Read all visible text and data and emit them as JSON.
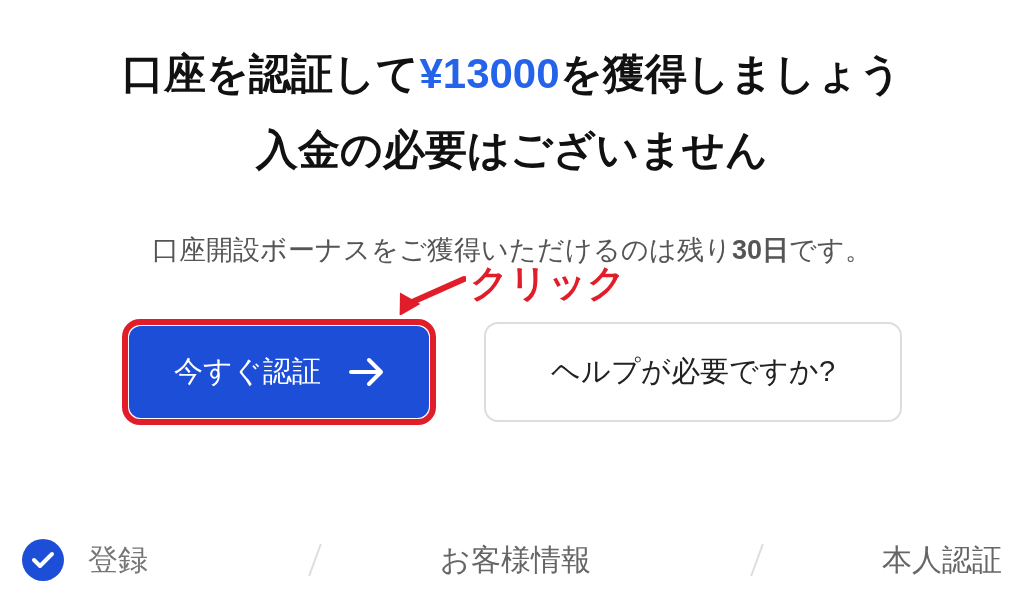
{
  "headline": {
    "line1_before": "口座を認証して",
    "line1_highlight": "¥13000",
    "line1_after": "を獲得しましょう",
    "line2": "入金の必要はございません"
  },
  "notice": "口座開設ボーナスをご獲得いただけるのは残り**30日**です。",
  "annotation": {
    "label": "クリック"
  },
  "buttons": [
    {
      "kind": "primary",
      "label": "今すぐ認証",
      "annotated": true
    },
    {
      "kind": "secondary",
      "label": "ヘルプが必要ですか?",
      "annotated": false
    }
  ],
  "steps": [
    {
      "label": "登録",
      "done": true
    },
    {
      "label": "お客様情報",
      "done": false
    },
    {
      "label": "本人認証",
      "done": false
    }
  ]
}
